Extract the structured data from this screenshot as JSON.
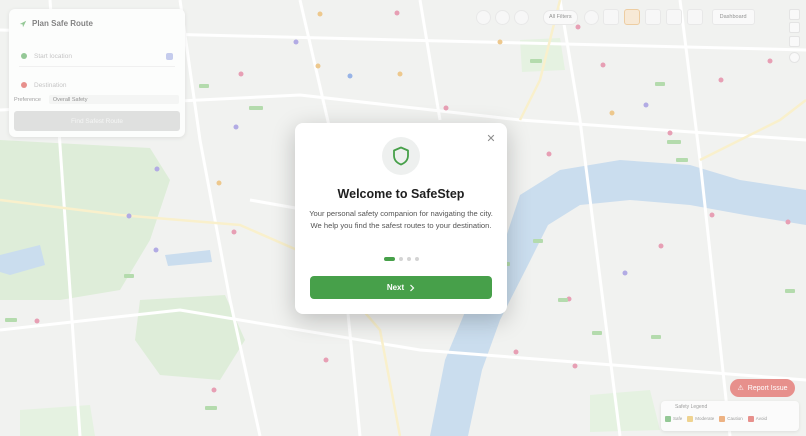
{
  "route_panel": {
    "title": "Plan Safe Route",
    "start_placeholder": "Start location",
    "destination_placeholder": "Destination",
    "preference_label": "Preference",
    "preference_value": "Overall Safety",
    "find_button": "Find Safest Route"
  },
  "toolbar": {
    "filter_label": "All Filters",
    "dashboard_label": "Dashboard"
  },
  "report_button": {
    "label": "Report Issue"
  },
  "legend": {
    "title": "Safety Legend",
    "items": [
      {
        "label": "Safe",
        "color": "#47a04a"
      },
      {
        "label": "Moderate",
        "color": "#e3b341"
      },
      {
        "label": "Caution",
        "color": "#e07b2a"
      },
      {
        "label": "Avoid",
        "color": "#d6403a"
      }
    ]
  },
  "modal": {
    "title": "Welcome to SafeStep",
    "description": "Your personal safety companion for navigating the city. We help you find the safest routes to your destination.",
    "next_button": "Next",
    "close_icon": "close-icon",
    "shield_icon": "shield-icon",
    "step_count": 4,
    "active_step": 1
  },
  "colors": {
    "accent": "#47a04a",
    "danger": "#d6403a",
    "water": "#9fc1e0",
    "park": "#bcdcb2"
  }
}
